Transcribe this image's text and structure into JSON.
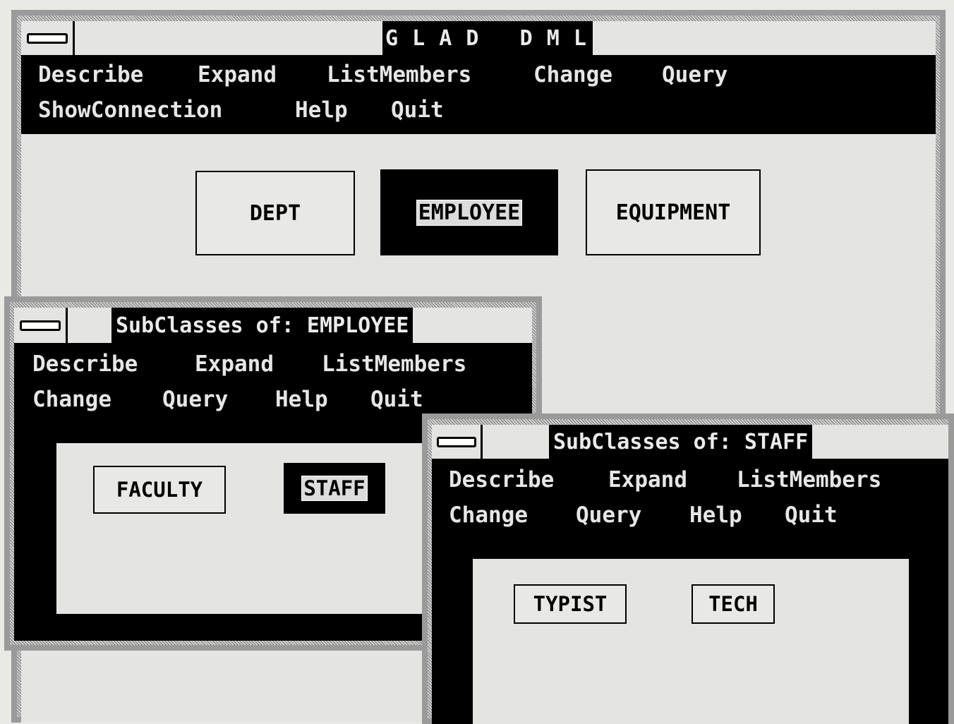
{
  "main_window": {
    "title": "G L A D   D M L",
    "menu_row1": [
      "Describe",
      "Expand",
      "ListMembers",
      "Change",
      "Query"
    ],
    "menu_row2": [
      "ShowConnection",
      "Help",
      "Quit"
    ],
    "classes": [
      "DEPT",
      "EMPLOYEE",
      "EQUIPMENT"
    ],
    "selected_class": "EMPLOYEE"
  },
  "employee_window": {
    "title": "SubClasses of: EMPLOYEE",
    "menu_row1": [
      "Describe",
      "Expand",
      "ListMembers"
    ],
    "menu_row2": [
      "Change",
      "Query",
      "Help",
      "Quit"
    ],
    "classes": [
      "FACULTY",
      "STAFF"
    ],
    "selected_class": "STAFF"
  },
  "staff_window": {
    "title": "SubClasses of: STAFF",
    "menu_row1": [
      "Describe",
      "Expand",
      "ListMembers"
    ],
    "menu_row2": [
      "Change",
      "Query",
      "Help",
      "Quit"
    ],
    "classes": [
      "TYPIST",
      "TECH"
    ]
  },
  "icons": [
    "system-menu-icon"
  ],
  "colors": {
    "menubar": "#000000",
    "client": "#e4e4e2",
    "frame": "#9a9a9a"
  }
}
